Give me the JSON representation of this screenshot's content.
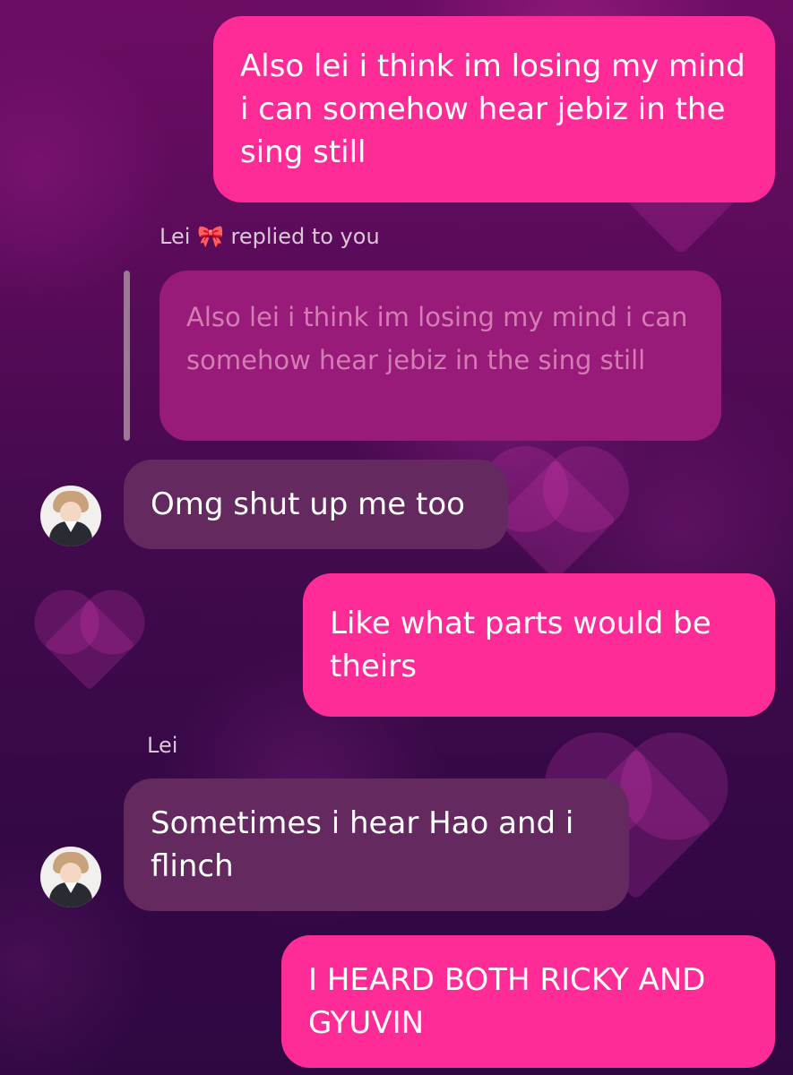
{
  "messages": [
    {
      "text": "Also lei i think im losing my mind i can somehow hear jebiz in the sing still"
    },
    {
      "reply_label": "Lei 🎀 replied to you",
      "quoted_text": "Also lei i think im losing my mind i can somehow hear jebiz in the sing still",
      "text": "Omg shut up me too"
    },
    {
      "text": "Like what parts would be theirs"
    },
    {
      "sender_label": "Lei",
      "text": "Sometimes i hear Hao and i flinch"
    },
    {
      "text": "I HEARD BOTH RICKY AND GYUVIN"
    }
  ]
}
